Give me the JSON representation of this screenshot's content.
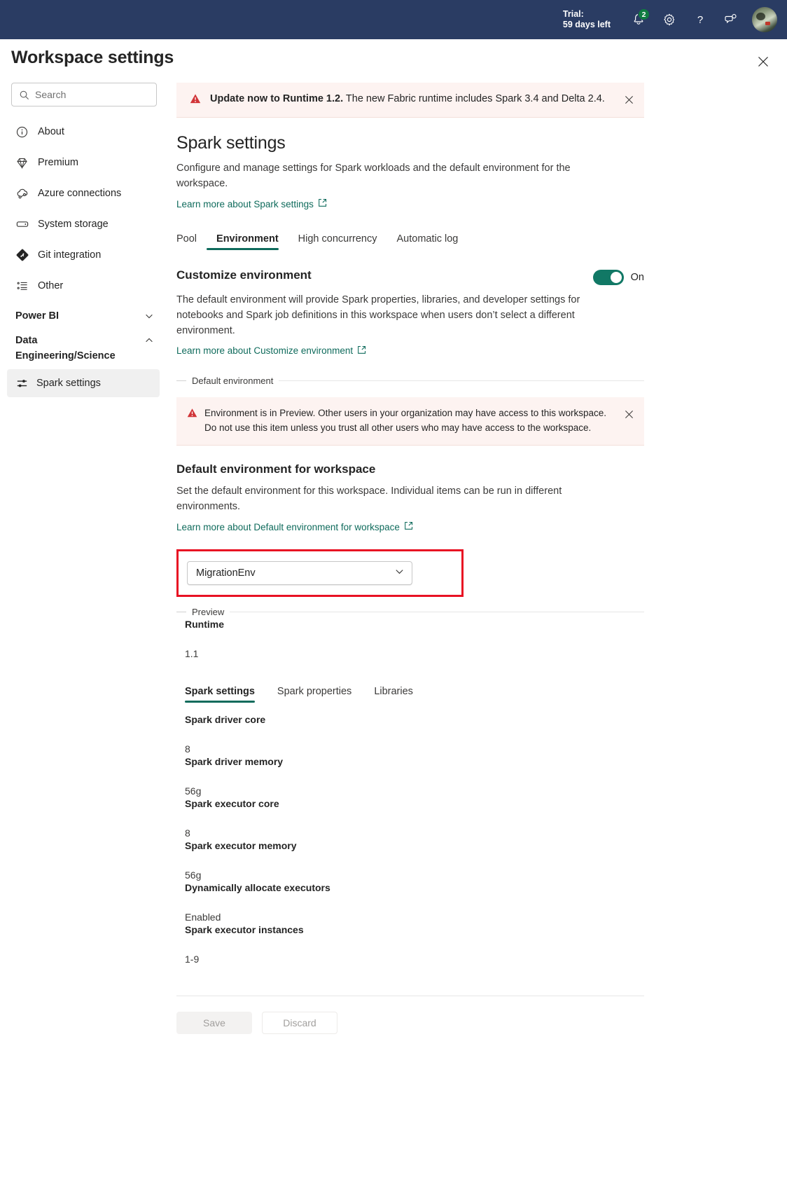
{
  "appbar": {
    "trial_line1": "Trial:",
    "trial_line2": "59 days left",
    "notifications_badge": "2",
    "icons": {
      "notifications": "bell-icon",
      "settings": "gear-icon",
      "help": "question-mark-icon",
      "feedback": "feedback-icon",
      "avatar": "user-avatar"
    },
    "brand_bg": "#2a3c63",
    "badge_color": "#107c41"
  },
  "page": {
    "title": "Workspace settings",
    "close_label": "Close"
  },
  "search": {
    "placeholder": "Search",
    "value": ""
  },
  "sidebar": {
    "items": [
      {
        "label": "About",
        "icon": "info-circle-icon"
      },
      {
        "label": "Premium",
        "icon": "diamond-icon"
      },
      {
        "label": "Azure connections",
        "icon": "cloud-link-icon"
      },
      {
        "label": "System storage",
        "icon": "storage-icon"
      },
      {
        "label": "Git integration",
        "icon": "git-diamond-icon"
      },
      {
        "label": "Other",
        "icon": "list-icon"
      }
    ],
    "groups": [
      {
        "label": "Power BI",
        "expanded": false,
        "chevron": "chevron-down-icon"
      },
      {
        "label": "Data Engineering/Science",
        "expanded": true,
        "chevron": "chevron-up-icon"
      }
    ],
    "selected_item": {
      "label": "Spark settings",
      "icon": "sliders-icon"
    }
  },
  "notice": {
    "bold": "Update now to Runtime 1.2.",
    "rest": " The new Fabric runtime includes Spark 3.4 and Delta 2.4.",
    "icon": "warning-triangle-icon",
    "dismiss": "close-icon",
    "bg": "#fdf3f1",
    "icon_color": "#d13438"
  },
  "section": {
    "title": "Spark settings",
    "description": "Configure and manage settings for Spark workloads and the default environment for the workspace.",
    "learn_more": "Learn more about Spark settings",
    "external_icon": "external-link-icon"
  },
  "tabs": [
    {
      "label": "Pool",
      "active": false
    },
    {
      "label": "Environment",
      "active": true
    },
    {
      "label": "High concurrency",
      "active": false
    },
    {
      "label": "Automatic log",
      "active": false
    }
  ],
  "customize": {
    "title": "Customize environment",
    "description": "The default environment will provide Spark properties, libraries, and developer settings for notebooks and Spark job definitions in this workspace when users don’t select a different environment.",
    "learn_more": "Learn more about Customize environment",
    "toggle_state": "On",
    "toggle_color": "#117865"
  },
  "default_env_fieldset": {
    "legend": "Default environment"
  },
  "preview_notice": {
    "line1": "Environment is in Preview. Other users in your organization may have access to this workspace.",
    "line2": "Do not use this item unless you trust all other users who may have access to the workspace.",
    "icon": "warning-triangle-icon",
    "dismiss": "close-icon"
  },
  "default_env": {
    "title": "Default environment for workspace",
    "description": "Set the default environment for this workspace. Individual items can be run in different environments.",
    "learn_more": "Learn more about Default environment for workspace",
    "selected": "MigrationEnv",
    "chevron": "chevron-down-icon",
    "highlight_color": "#e81123"
  },
  "preview_fieldset": {
    "legend": "Preview"
  },
  "runtime": {
    "label": "Runtime",
    "value": "1.1"
  },
  "inner_tabs": [
    {
      "label": "Spark settings",
      "active": true
    },
    {
      "label": "Spark properties",
      "active": false
    },
    {
      "label": "Libraries",
      "active": false
    }
  ],
  "spark_settings": [
    {
      "label": "Spark driver core",
      "value": "8"
    },
    {
      "label": "Spark driver memory",
      "value": "56g"
    },
    {
      "label": "Spark executor core",
      "value": "8"
    },
    {
      "label": "Spark executor memory",
      "value": "56g"
    },
    {
      "label": "Dynamically allocate executors",
      "value": "Enabled"
    },
    {
      "label": "Spark executor instances",
      "value": "1-9"
    }
  ],
  "footer": {
    "save_label": "Save",
    "discard_label": "Discard"
  }
}
